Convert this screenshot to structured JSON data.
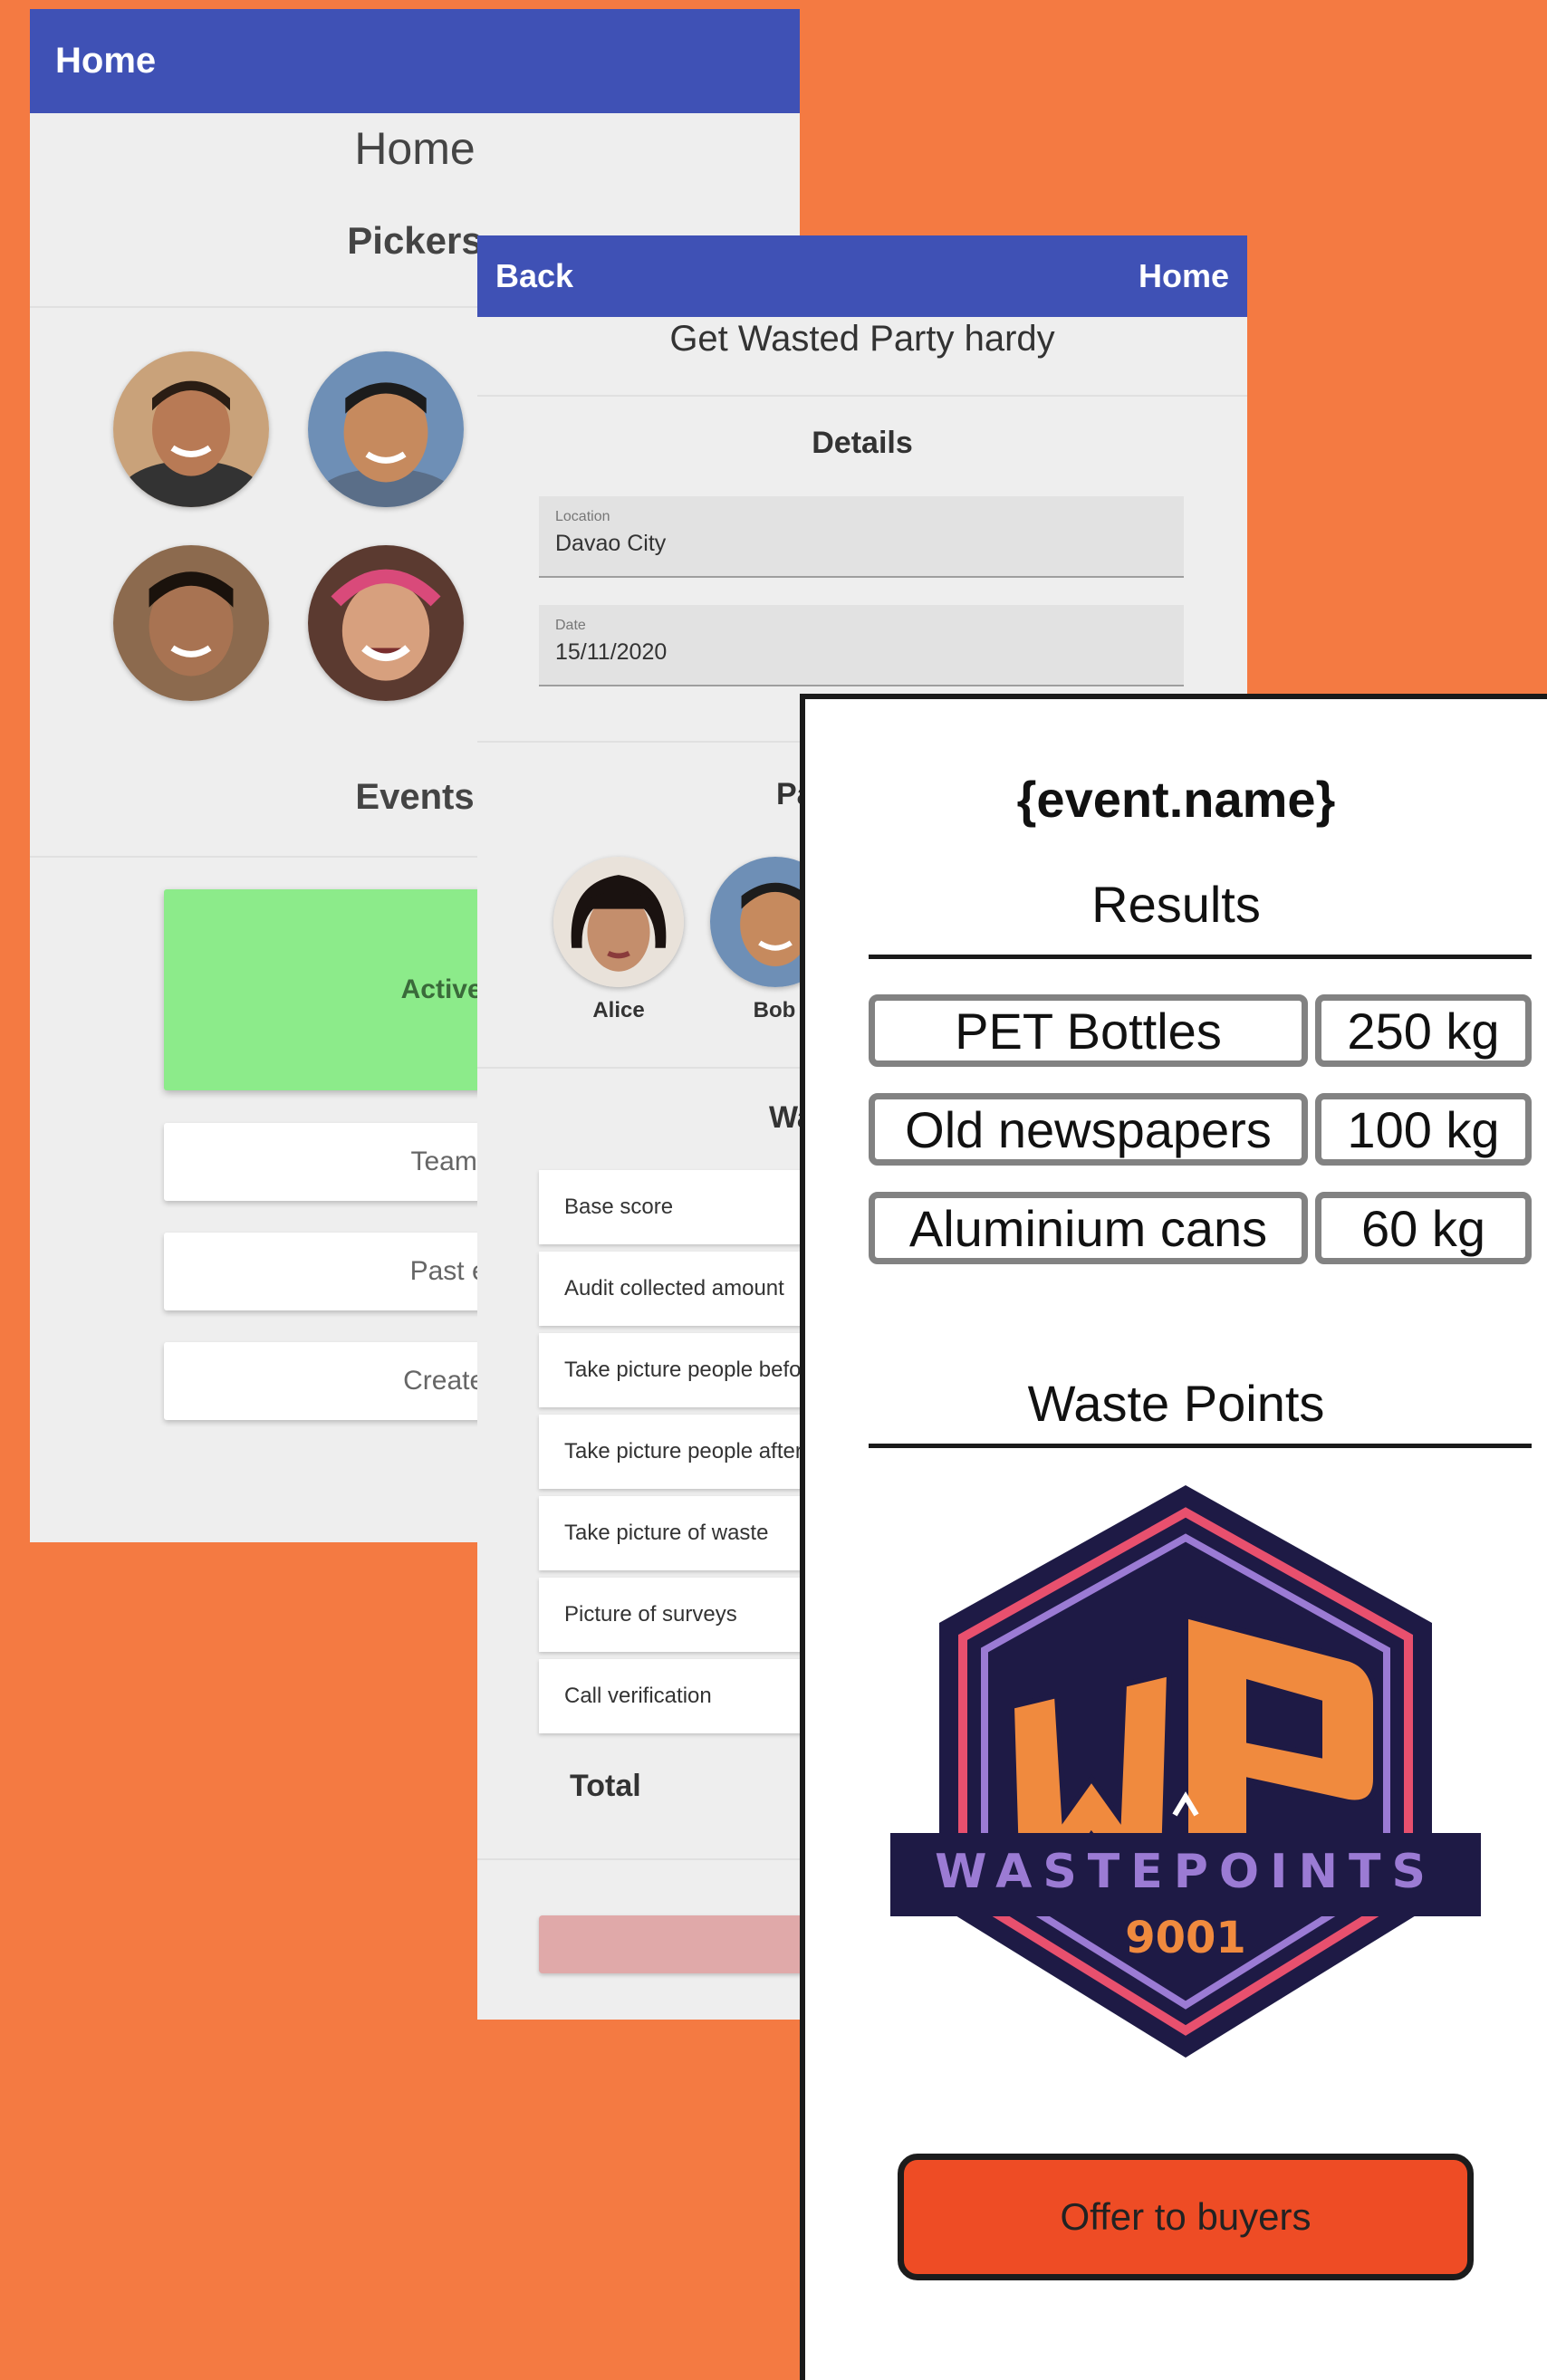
{
  "home_screen": {
    "appbar_title": "Home",
    "title": "Home",
    "pickers_label": "Pickers",
    "events_label": "Events",
    "active_event_label": "Active event",
    "buttons": [
      "Team score",
      "Past events",
      "Create event"
    ]
  },
  "event_screen": {
    "back_label": "Back",
    "home_label": "Home",
    "event_title": "Get Wasted Party hardy",
    "details_label": "Details",
    "location": {
      "label": "Location",
      "value": "Davao City"
    },
    "date": {
      "label": "Date",
      "value": "15/11/2020"
    },
    "participants_label": "Pa",
    "participants": [
      "Alice",
      "Bob"
    ],
    "waste_label": "Wa",
    "tasks": [
      "Base score",
      "Audit collected amount",
      "Take picture people before",
      "Take picture people after",
      "Take picture of waste",
      "Picture of surveys",
      "Call verification"
    ],
    "total_label": "Total"
  },
  "results_screen": {
    "event_name": "{event.name}",
    "results_label": "Results",
    "results": [
      {
        "material": "PET Bottles",
        "amount": "250 kg"
      },
      {
        "material": "Old newspapers",
        "amount": "100 kg"
      },
      {
        "material": "Aluminium cans",
        "amount": "60 kg"
      }
    ],
    "waste_points_label": "Waste Points",
    "logo": {
      "brand": "WASTEPOINTS",
      "number": "9001",
      "monogram": "WP"
    },
    "offer_button_label": "Offer to buyers"
  },
  "colors": {
    "background": "#F47A42",
    "appbar": "#3F51B5",
    "active_event": "#8CEB8A",
    "offer_button": "#EE4C25",
    "logo_navy": "#1E1A45",
    "logo_orange": "#F08A3E",
    "logo_purple": "#9B7BD4",
    "logo_pink": "#E8506E"
  }
}
